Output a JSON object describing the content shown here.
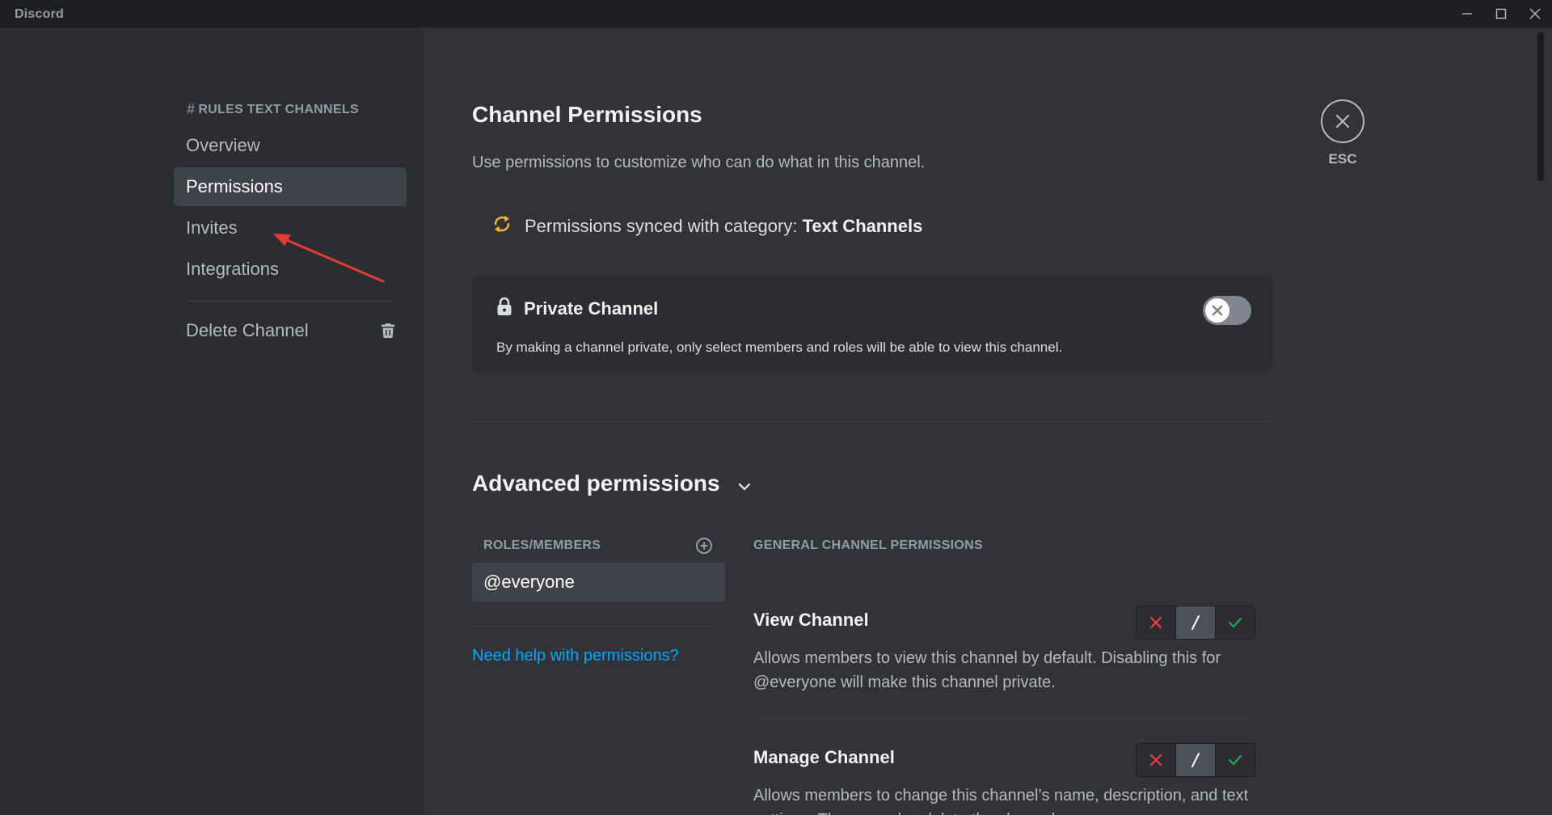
{
  "app": {
    "title": "Discord"
  },
  "sidebar": {
    "heading_hash": "#",
    "heading": "RULES TEXT CHANNELS",
    "items": [
      {
        "label": "Overview",
        "active": false
      },
      {
        "label": "Permissions",
        "active": true
      },
      {
        "label": "Invites",
        "active": false
      },
      {
        "label": "Integrations",
        "active": false
      }
    ],
    "delete_label": "Delete Channel"
  },
  "main": {
    "title": "Channel Permissions",
    "description": "Use permissions to customize who can do what in this channel.",
    "sync": {
      "text": "Permissions synced with category:",
      "category": "Text Channels"
    },
    "private_channel": {
      "title": "Private Channel",
      "description": "By making a channel private, only select members and roles will be able to view this channel.",
      "enabled": false
    },
    "advanced": {
      "title": "Advanced permissions",
      "roles_label": "ROLES/MEMBERS",
      "roles": [
        "@everyone"
      ],
      "help_link": "Need help with permissions?",
      "general_label": "GENERAL CHANNEL PERMISSIONS",
      "permissions": [
        {
          "name": "View Channel",
          "description": "Allows members to view this channel by default. Disabling this for @everyone will make this channel private.",
          "state": "neutral"
        },
        {
          "name": "Manage Channel",
          "description": "Allows members to change this channel’s name, description, and text settings. They can also delete the channel.",
          "state": "neutral"
        }
      ]
    },
    "close": {
      "label": "ESC"
    }
  },
  "colors": {
    "deny": "#f23f43",
    "allow": "#23a55a",
    "sync_icon": "#f0b232",
    "link": "#00a8fc",
    "annotation_arrow": "#e53935"
  },
  "icons": {
    "sync": "sync-icon",
    "lock": "lock-icon",
    "trash": "trash-icon",
    "add": "add-circle-icon",
    "chevron": "chevron-down-icon",
    "close": "close-icon"
  }
}
